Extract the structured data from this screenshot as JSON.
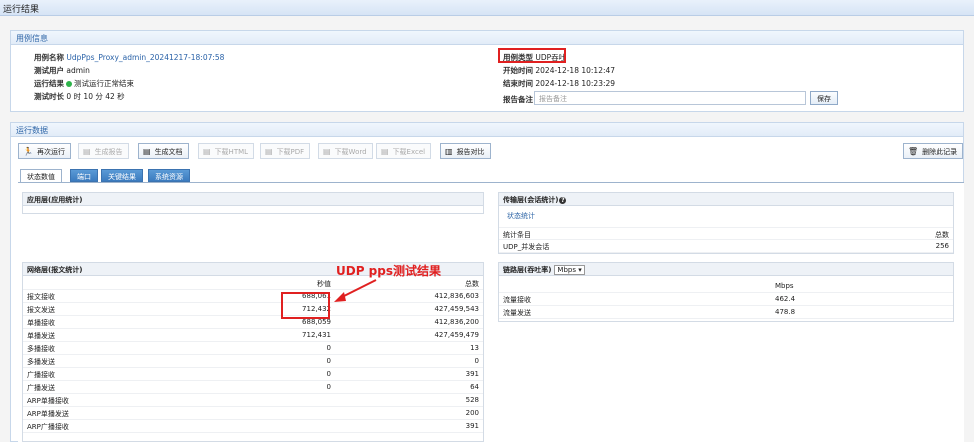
{
  "window": {
    "title": "运行结果"
  },
  "case_info": {
    "header": "用例信息",
    "name_label": "用例名称",
    "name_value": "UdpPps_Proxy_admin_20241217-18:07:58",
    "user_label": "测试用户",
    "user_value": "admin",
    "result_label": "运行结果",
    "result_value": "测试运行正常结束",
    "duration_label": "测试时长",
    "duration_value": "0 时 10 分 42 秒",
    "type_label": "用例类型",
    "type_value": "UDP吞吐",
    "start_label": "开始时间",
    "start_value": "2024-12-18 10:12:47",
    "end_label": "结束时间",
    "end_value": "2024-12-18 10:23:29",
    "remark_label": "报告备注",
    "remark_placeholder": "报告备注",
    "save_label": "保存"
  },
  "run_data": {
    "header": "运行数据",
    "toolbar": {
      "rerun": "再次运行",
      "gen_report": "生成报告",
      "gen_doc": "生成文档",
      "dl_html": "下载HTML",
      "dl_pdf": "下载PDF",
      "dl_word": "下载Word",
      "dl_excel": "下载Excel",
      "compare": "报告对比",
      "delete": "删除此记录"
    },
    "tabs": [
      "状态数值",
      "端口",
      "关键结果",
      "系统资源"
    ]
  },
  "app_layer": {
    "title": "应用层(应用统计)"
  },
  "net_layer": {
    "title": "网络层(报文统计)",
    "col_rate": "秒值",
    "col_total": "总数",
    "rows": [
      {
        "name": "报文接收",
        "rate": "688,061",
        "total": "412,836,603"
      },
      {
        "name": "报文发送",
        "rate": "712,432",
        "total": "427,459,543"
      },
      {
        "name": "单播接收",
        "rate": "688,059",
        "total": "412,836,200"
      },
      {
        "name": "单播发送",
        "rate": "712,431",
        "total": "427,459,479"
      },
      {
        "name": "多播接收",
        "rate": "0",
        "total": "13"
      },
      {
        "name": "多播发送",
        "rate": "0",
        "total": "0"
      },
      {
        "name": "广播接收",
        "rate": "0",
        "total": "391"
      },
      {
        "name": "广播发送",
        "rate": "0",
        "total": "64"
      },
      {
        "name": "ARP单播接收",
        "rate": "",
        "total": "528"
      },
      {
        "name": "ARP单播发送",
        "rate": "",
        "total": "200"
      },
      {
        "name": "ARP广播接收",
        "rate": "",
        "total": "391"
      }
    ]
  },
  "transport_layer": {
    "title": "传输层(会话统计)",
    "subtab": "状态统计",
    "col_item": "统计条目",
    "col_total": "总数",
    "rows": [
      {
        "name": "UDP_并发会话",
        "total": "256"
      }
    ]
  },
  "link_layer": {
    "title": "链路层(吞吐率)",
    "unit_option": "Mbps",
    "col_unit": "Mbps",
    "rows": [
      {
        "name": "流量接收",
        "value": "462.4"
      },
      {
        "name": "流量发送",
        "value": "478.8"
      }
    ]
  },
  "annotation": {
    "text": "UDP pps测试结果"
  },
  "colors": {
    "accent": "#2f66a7",
    "highlight": "#e02020",
    "tab_blue": "#3b7bbf"
  }
}
